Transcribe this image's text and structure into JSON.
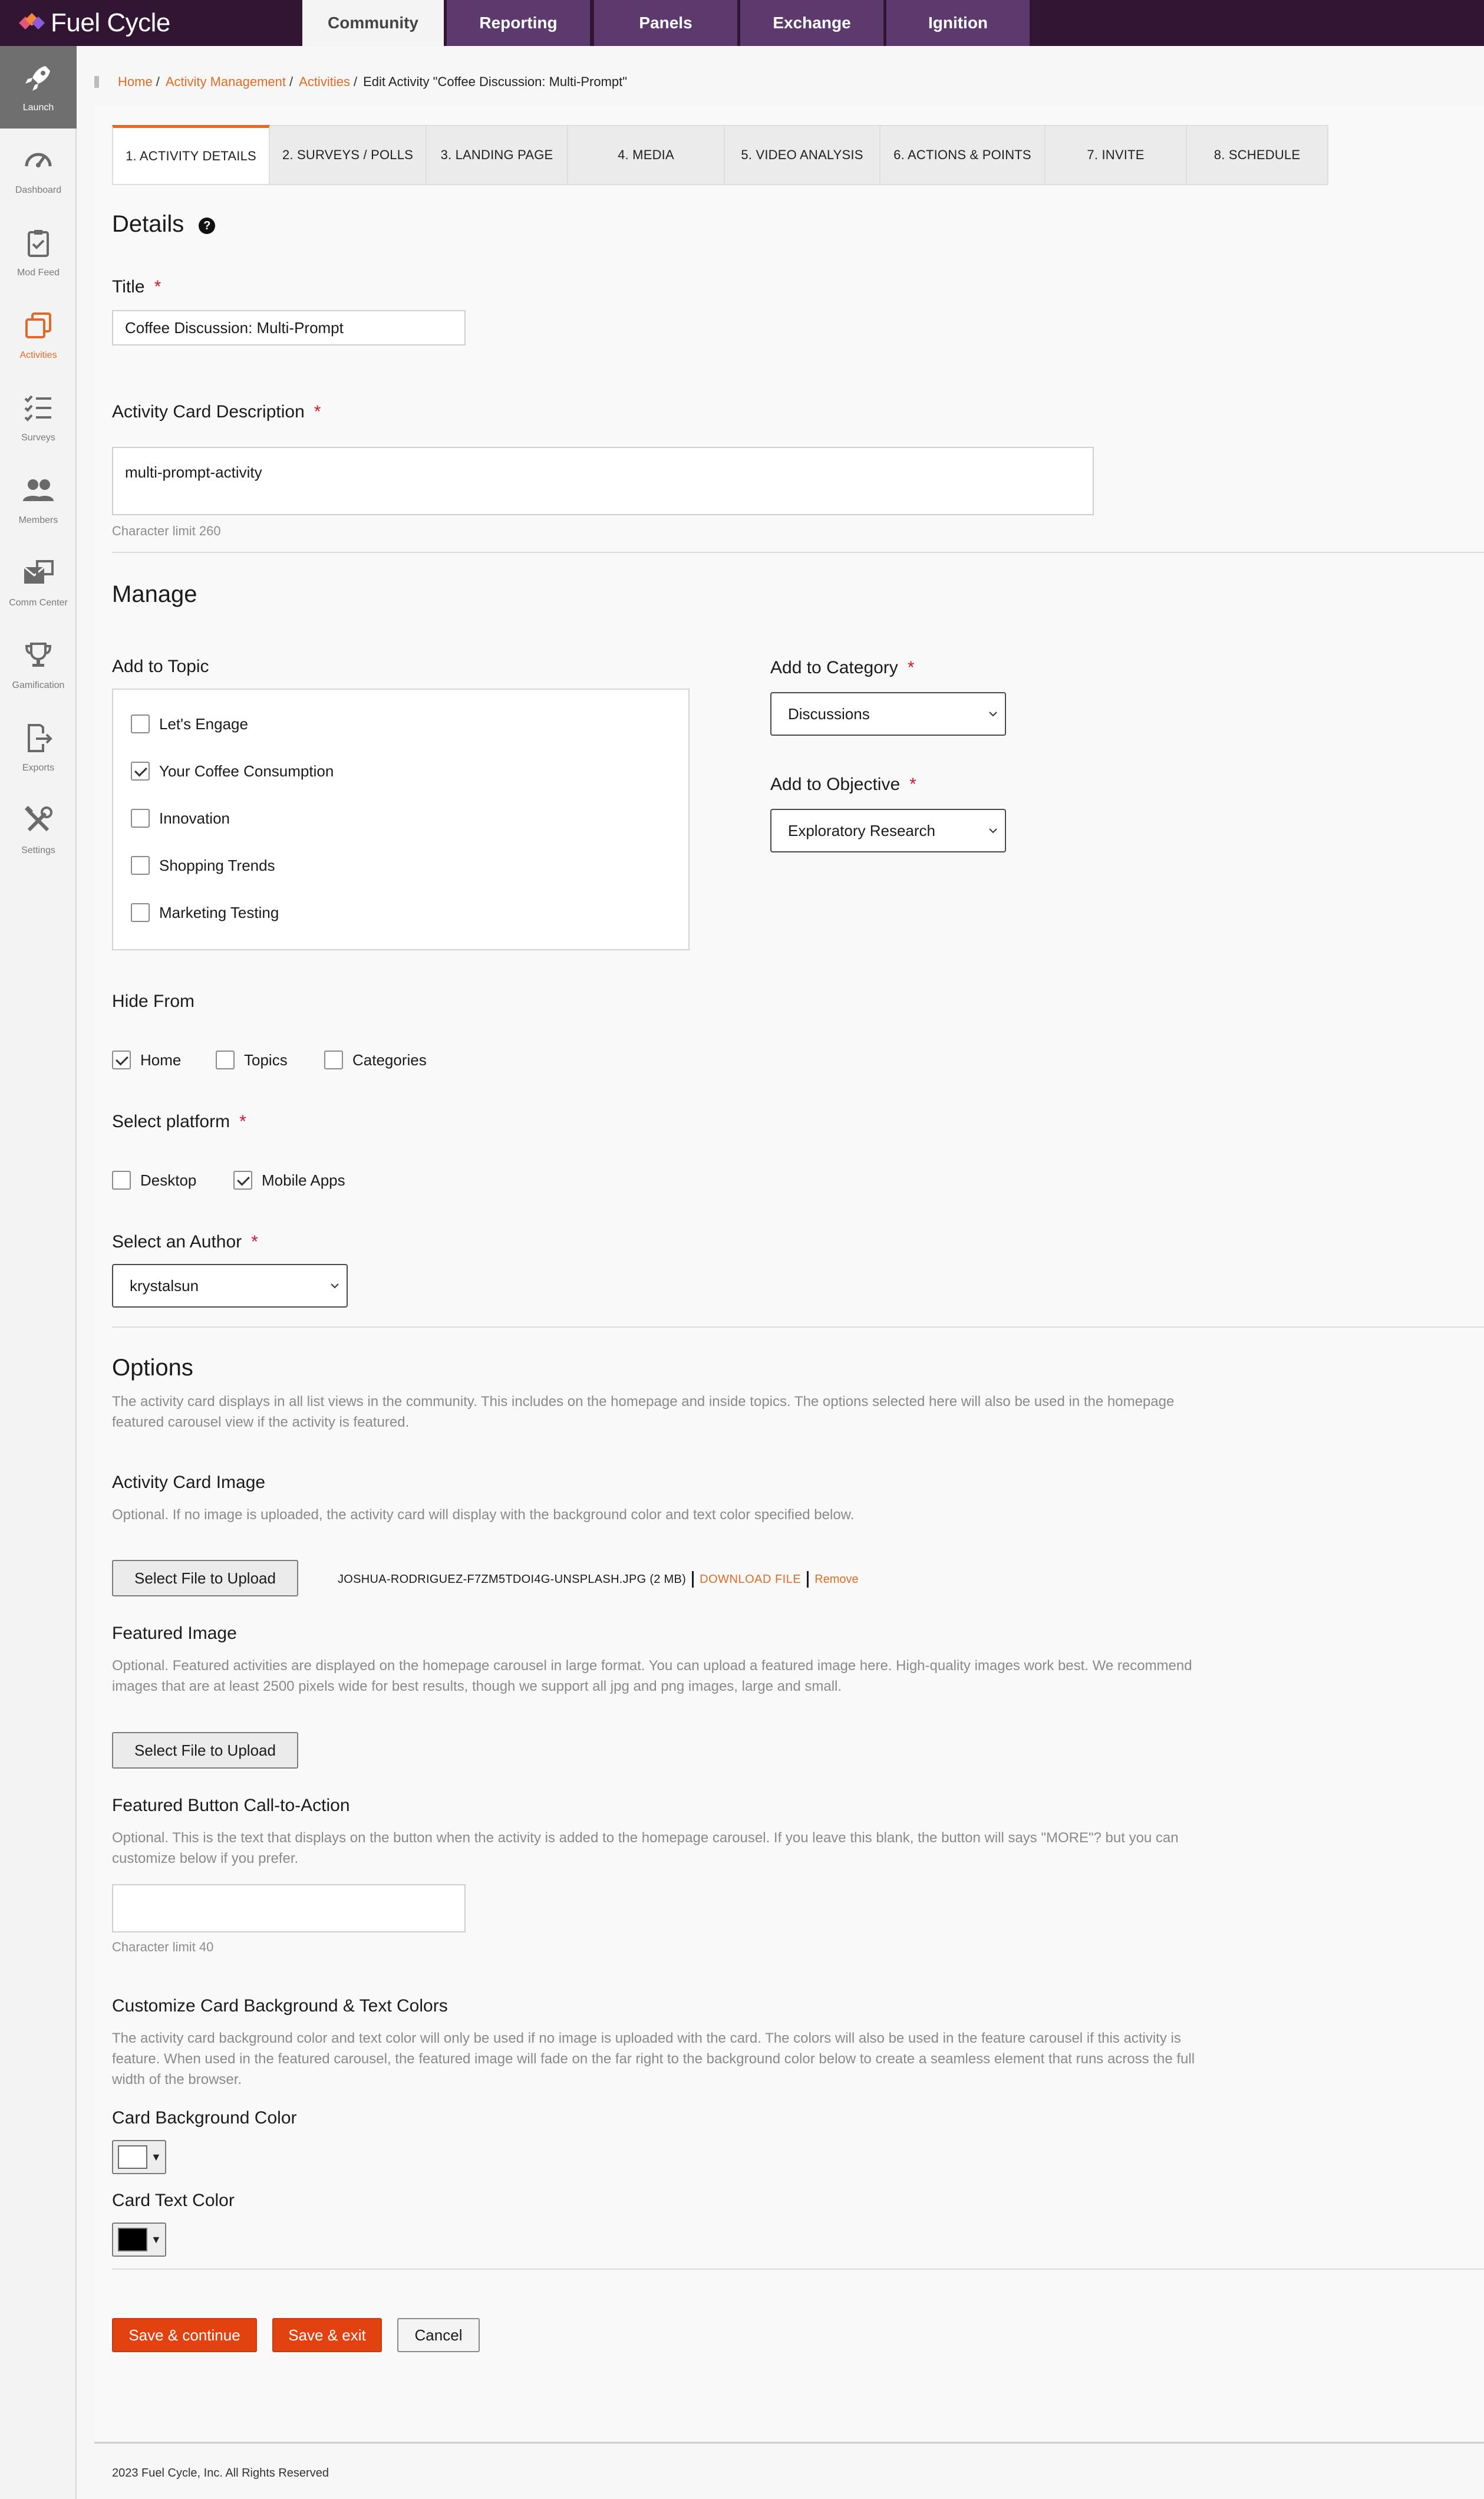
{
  "app": {
    "brand": "Fuel Cycle",
    "nav_tabs": [
      {
        "label": "Community",
        "active": true
      },
      {
        "label": "Reporting"
      },
      {
        "label": "Panels"
      },
      {
        "label": "Exchange"
      },
      {
        "label": "Ignition"
      }
    ]
  },
  "sidebar": {
    "items": [
      {
        "label": "Launch",
        "icon": "rocket-icon"
      },
      {
        "label": "Dashboard",
        "icon": "gauge-icon"
      },
      {
        "label": "Mod Feed",
        "icon": "clipboard-icon"
      },
      {
        "label": "Activities",
        "icon": "activities-icon"
      },
      {
        "label": "Surveys",
        "icon": "checklist-icon"
      },
      {
        "label": "Members",
        "icon": "members-icon"
      },
      {
        "label": "Comm Center",
        "icon": "mail-icon"
      },
      {
        "label": "Gamification",
        "icon": "trophy-icon"
      },
      {
        "label": "Exports",
        "icon": "export-icon"
      },
      {
        "label": "Settings",
        "icon": "tools-icon"
      }
    ]
  },
  "breadcrumb": {
    "home": "Home",
    "activity_management": "Activity Management",
    "activities": "Activities",
    "sep": "/",
    "current": "Edit Activity \"Coffee Discussion: Multi-Prompt\""
  },
  "steps": [
    {
      "label": "1. ACTIVITY DETAILS",
      "active": true
    },
    {
      "label": "2. SURVEYS / POLLS"
    },
    {
      "label": "3. LANDING PAGE"
    },
    {
      "label": "4. MEDIA"
    },
    {
      "label": "5. VIDEO ANALYSIS"
    },
    {
      "label": "6. ACTIONS & POINTS"
    },
    {
      "label": "7. INVITE"
    },
    {
      "label": "8. SCHEDULE"
    }
  ],
  "details": {
    "heading": "Details",
    "help_glyph": "?",
    "title_label": "Title",
    "required_mark": "*",
    "title_value": "Coffee Discussion: Multi-Prompt",
    "desc_label": "Activity Card Description",
    "desc_value": "multi-prompt-activity",
    "desc_limit": "Character limit 260"
  },
  "manage": {
    "heading": "Manage",
    "topic_label": "Add to Topic",
    "topics": [
      {
        "label": "Let's Engage",
        "checked": false
      },
      {
        "label": "Your Coffee Consumption",
        "checked": true
      },
      {
        "label": "Innovation",
        "checked": false
      },
      {
        "label": "Shopping Trends",
        "checked": false
      },
      {
        "label": "Marketing Testing",
        "checked": false
      }
    ],
    "category_label": "Add to Category",
    "category_value": "Discussions",
    "objective_label": "Add to Objective",
    "objective_value": "Exploratory Research",
    "hide_label": "Hide From",
    "hide_options": [
      {
        "label": "Home",
        "checked": true
      },
      {
        "label": "Topics",
        "checked": false
      },
      {
        "label": "Categories",
        "checked": false
      }
    ],
    "platform_label": "Select platform",
    "platform_options": [
      {
        "label": "Desktop",
        "checked": false
      },
      {
        "label": "Mobile Apps",
        "checked": true
      }
    ],
    "author_label": "Select an Author",
    "author_value": "krystalsun"
  },
  "options": {
    "heading": "Options",
    "intro_1": "The activity card displays in all list views in the community. This includes on the homepage and inside topics. The options selected here will also be used in the homepage",
    "intro_2": "featured carousel view if the activity is featured.",
    "card_image_label": "Activity Card Image",
    "card_image_help": "Optional. If no image is uploaded, the activity card will display with the background color and text color specified below.",
    "upload_label": "Select File to Upload",
    "file_name": "JOSHUA-RODRIGUEZ-F7ZM5TDOI4G-UNSPLASH.JPG (2 MB)",
    "download_label": "DOWNLOAD FILE",
    "remove_label": "Remove",
    "featured_label": "Featured Image",
    "featured_help_1": "Optional. Featured activities are displayed on the homepage carousel in large format. You can upload a featured image here. High-quality images work best. We recommend",
    "featured_help_2": "images that are at least 2500 pixels wide for best results, though we support all jpg and png images, large and small.",
    "featured_upload_label": "Select File to Upload",
    "cta_label": "Featured Button Call-to-Action",
    "cta_help_1": "Optional. This is the text that displays on the button when the activity is added to the homepage carousel. If you leave this blank, the button will says \"MORE\"? but you can",
    "cta_help_2": "customize below if you prefer.",
    "cta_value": "",
    "cta_limit": "Character limit 40",
    "colors_label": "Customize Card Background & Text Colors",
    "colors_help_1": "The activity card background color and text color will only be used if no image is uploaded with the card. The colors will also be used in the feature carousel if this activity is",
    "colors_help_2": "feature. When used in the featured carousel, the featured image will fade on the far right to the background color below to create a seamless element that runs across the full",
    "colors_help_3": "width of the browser.",
    "bg_color_label": "Card Background Color",
    "bg_color": "#ffffff",
    "text_color_label": "Card Text Color",
    "text_color": "#000000",
    "picker_arrow": "▼"
  },
  "actions": {
    "save_continue": "Save & continue",
    "save_exit": "Save & exit",
    "cancel": "Cancel"
  },
  "footer": {
    "text": "2023 Fuel Cycle, Inc. All Rights Reserved"
  },
  "colors": {
    "topbar": "#321433",
    "accent": "#e16b25",
    "primary_button": "#e1420f",
    "required": "#d9182d"
  }
}
